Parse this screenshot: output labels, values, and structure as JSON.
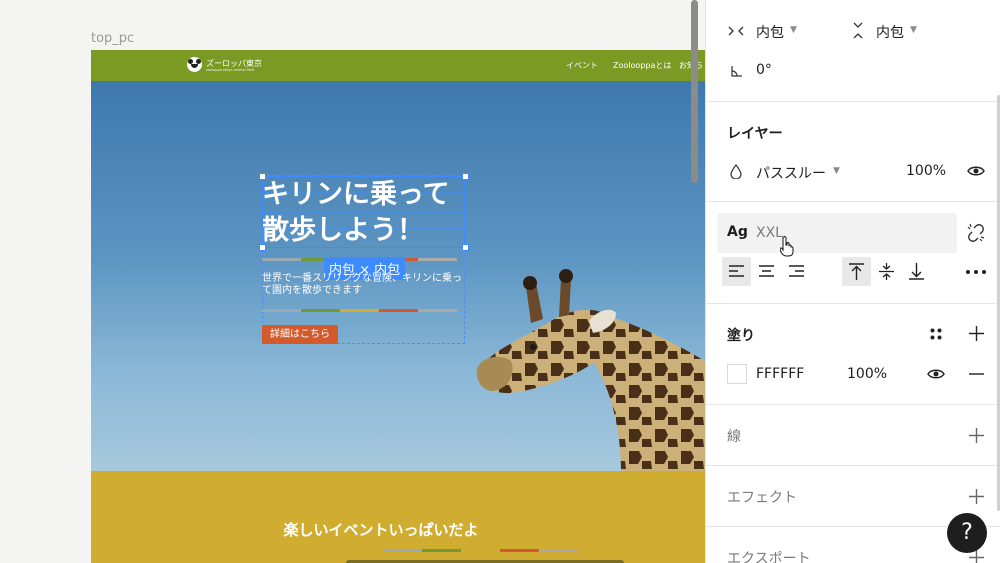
{
  "canvas": {
    "frame_label": "top_pc",
    "site": {
      "logo_name": "ズーロッパ東京",
      "logo_sub": "zooloppa tokyo animal field",
      "nav": [
        "イベント",
        "Zoolooppaとは",
        "お知ら"
      ],
      "hero_title_lines": [
        "キリンに乗って",
        "散歩しよう！"
      ],
      "hug_badge": "内包 × 内包",
      "hero_desc": "世界で一番スリリングな冒険、キリンに乗って園内を散歩できます",
      "cta_label": "詳細はこちら",
      "section_title": "楽しいイベントいっぱいだよ"
    },
    "colors": {
      "header_green": "#7a9a23",
      "cta_orange": "#d35a2d",
      "section_yellow": "#d0ad31",
      "selection_blue": "#3d8bff",
      "bar_segments": [
        "#9aa9b8",
        "#6f9a35",
        "#d2ab33",
        "#cf5a34",
        "#a9a9a9"
      ]
    }
  },
  "panel": {
    "width_mode": "内包",
    "height_mode": "内包",
    "rotation": "0°",
    "layer": {
      "title": "レイヤー",
      "blend_mode": "パススルー",
      "opacity": "100%"
    },
    "typography": {
      "ag": "Ag",
      "style_name": "XXL"
    },
    "fill": {
      "title": "塗り",
      "hex": "FFFFFF",
      "opacity": "100%"
    },
    "stroke_title": "線",
    "effect_title": "エフェクト",
    "export_title": "エクスポート",
    "help": "?"
  }
}
